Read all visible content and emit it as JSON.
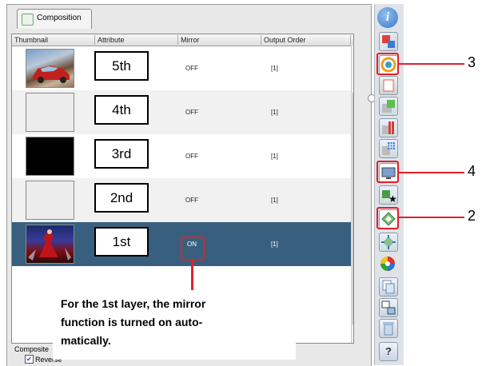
{
  "window": {
    "tab_label": "Composition",
    "columns": [
      "Thumbnail",
      "Attribute",
      "Mirror",
      "Output Order"
    ]
  },
  "rows": [
    {
      "attribute": "5th",
      "mirror": "OFF",
      "order": "[1]",
      "thumb": "car-photo"
    },
    {
      "attribute": "4th",
      "mirror": "OFF",
      "order": "[1]",
      "thumb": "blank-white"
    },
    {
      "attribute": "3rd",
      "mirror": "OFF",
      "order": "[1]",
      "thumb": "black"
    },
    {
      "attribute": "2nd",
      "mirror": "OFF",
      "order": "[1]",
      "thumb": "blank-white"
    },
    {
      "attribute": "1st",
      "mirror": "ON",
      "order": "[1]",
      "thumb": "fantasy-art",
      "selected": true
    }
  ],
  "bottom": {
    "composite_label": "Composite",
    "reverse_label": "Reverse",
    "reverse_checked": true
  },
  "callouts": {
    "num_3": "3",
    "num_4": "4",
    "num_2": "2",
    "note": "For the 1st layer, the mirror function is turned on auto-matically.",
    "note_line1": "For the 1st layer, the mirror",
    "note_line2": "function is turned on auto-",
    "note_line3": "matically."
  },
  "toolbar_icons": [
    "info-icon",
    "layer-settings-icon",
    "color-layer-icon",
    "blank-layer-icon",
    "plus-layer-icon",
    "bars-layer-icon",
    "grid-layer-icon",
    "monitor-icon",
    "layer-star-icon",
    "diamond-layer-icon",
    "diamond-arrows-icon",
    "color-wheel-icon",
    "copy-icon",
    "split-icon",
    "trash-icon",
    "help-icon"
  ],
  "colors": {
    "selection": "#38607e",
    "callout_red": "#e0202a",
    "info_blue": "#3b78c8"
  }
}
